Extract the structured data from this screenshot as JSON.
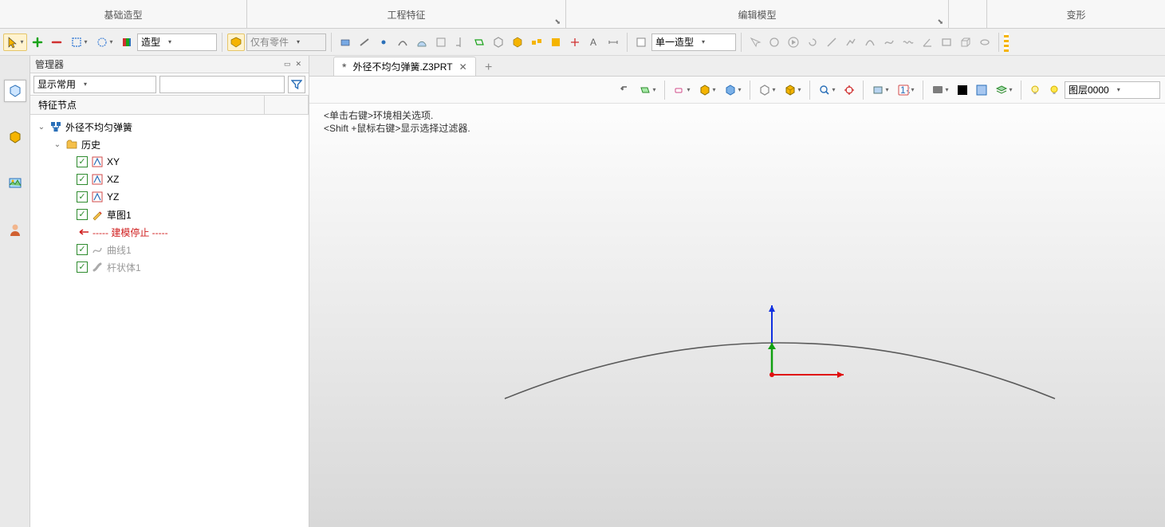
{
  "ribbon": {
    "cats": [
      "基础造型",
      "工程特征",
      "编辑模型",
      "",
      "变形"
    ]
  },
  "toolbar1": {
    "mode_combo": "造型",
    "scope_combo": "仅有零件",
    "build_combo": "单一造型"
  },
  "manager": {
    "title": "管理器",
    "filter_combo": "显示常用",
    "head_col": "特征节点",
    "tree": {
      "root": "外径不均匀弹簧",
      "history": "历史",
      "xy": "XY",
      "xz": "XZ",
      "yz": "YZ",
      "sketch": "草图1",
      "stop": "----- 建模停止 -----",
      "curve": "曲线1",
      "body": "杆状体1"
    }
  },
  "tabs": {
    "active": "外径不均匀弹簧.Z3PRT"
  },
  "view": {
    "layer_combo": "图层0000"
  },
  "hints": {
    "l1": "<单击右键>环境相关选项.",
    "l2": "<Shift +鼠标右键>显示选择过滤器."
  }
}
